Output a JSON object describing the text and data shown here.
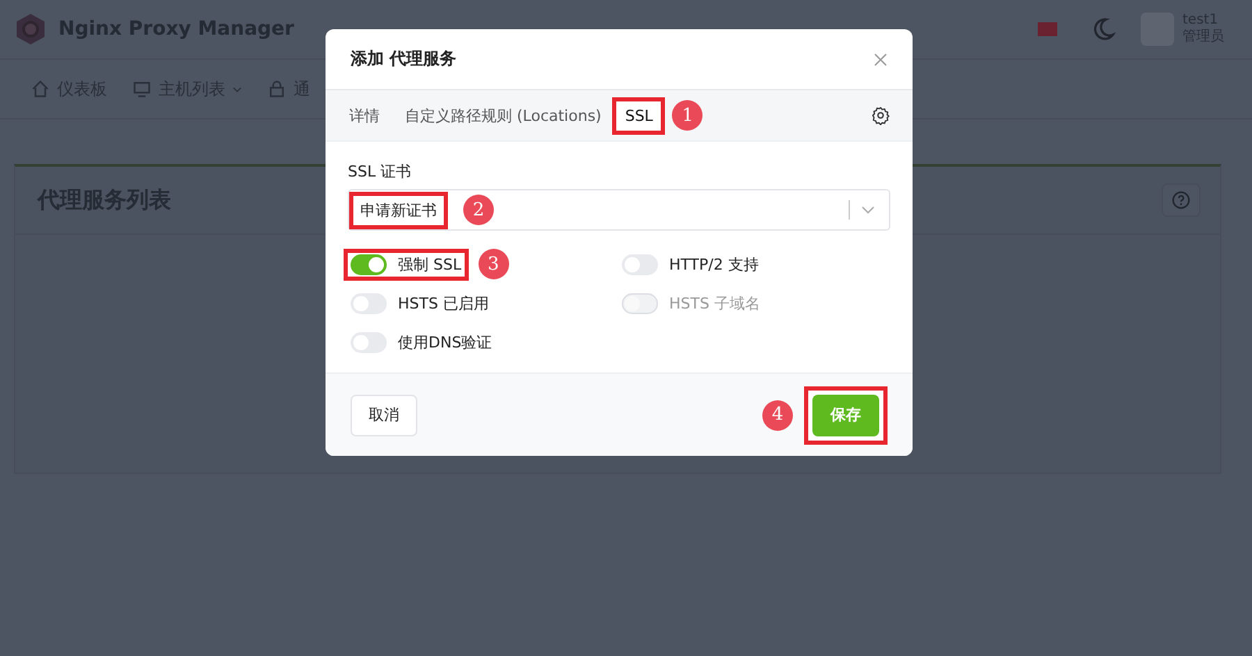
{
  "header": {
    "brand": "Nginx Proxy Manager",
    "user": {
      "name": "test1",
      "role": "管理员"
    }
  },
  "nav": [
    {
      "label": "仪表板",
      "dropdown": false
    },
    {
      "label": "主机列表",
      "dropdown": true
    },
    {
      "label": "通",
      "dropdown": false
    }
  ],
  "card": {
    "title": "代理服务列表"
  },
  "modal": {
    "title": "添加 代理服务",
    "tabs": [
      {
        "label": "详情",
        "selected": false
      },
      {
        "label": "自定义路径规则 (Locations)",
        "selected": false
      },
      {
        "label": "SSL",
        "selected": true,
        "callout": "1"
      }
    ],
    "certificate": {
      "label": "SSL 证书",
      "value": "申请新证书",
      "callout": "2"
    },
    "toggles": [
      {
        "label": "强制 SSL",
        "on": true,
        "disabled": false,
        "callout": "3"
      },
      {
        "label": "HTTP/2 支持",
        "on": false,
        "disabled": false
      },
      {
        "label": "HSTS 已启用",
        "on": false,
        "disabled": false
      },
      {
        "label": "HSTS 子域名",
        "on": false,
        "disabled": true
      },
      {
        "label": "使用DNS验证",
        "on": false,
        "disabled": false
      }
    ],
    "buttons": [
      {
        "label": "取消",
        "kind": "secondary"
      },
      {
        "label": "保存",
        "kind": "primary",
        "callout": "4"
      }
    ]
  }
}
